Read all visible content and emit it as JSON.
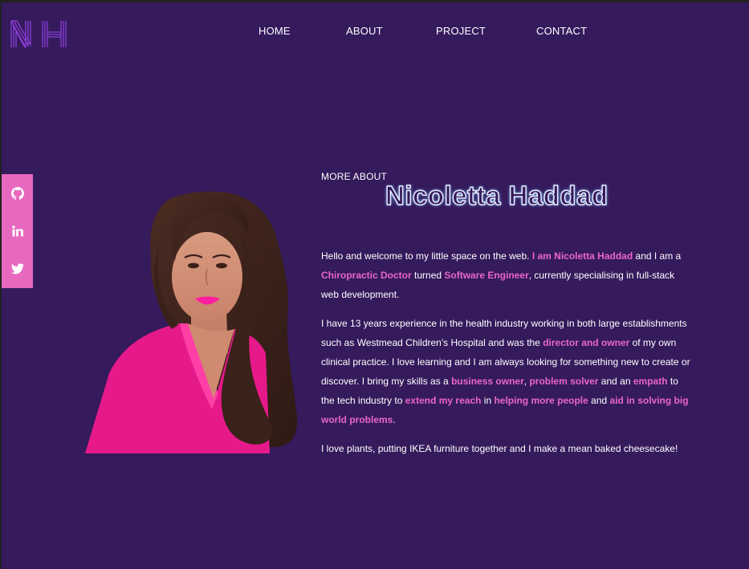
{
  "logo": {
    "text": "NH",
    "icon": "nh-monogram-logo"
  },
  "nav": {
    "home": "HOME",
    "about": "ABOUT",
    "project": "PROJECT",
    "contact": "CONTACT"
  },
  "social": {
    "github_icon": "github-icon",
    "linkedin_icon": "linkedin-icon",
    "twitter_icon": "twitter-icon"
  },
  "about": {
    "kicker": "MORE ABOUT",
    "name": "Nicoletta Haddad",
    "p1": [
      {
        "t": "Hello and welcome to my little space on the web. ",
        "hl": false
      },
      {
        "t": "I am Nicoletta Haddad",
        "hl": true
      },
      {
        "t": " and I am a ",
        "hl": false
      },
      {
        "t": "Chiropractic Doctor",
        "hl": true
      },
      {
        "t": " turned ",
        "hl": false
      },
      {
        "t": "Software Engineer",
        "hl": true
      },
      {
        "t": ", currently specialising in full-stack web development.",
        "hl": false
      }
    ],
    "p2": [
      {
        "t": "I have 13 years experience in the health industry working in both large establishments such as Westmead Children's Hospital and was the ",
        "hl": false
      },
      {
        "t": "director and owner",
        "hl": true
      },
      {
        "t": " of my own clinical practice. I love learning and I am always looking for something new to create or discover. I bring my skills as a ",
        "hl": false
      },
      {
        "t": "business owner",
        "hl": true
      },
      {
        "t": ", ",
        "hl": false
      },
      {
        "t": "problem solver",
        "hl": true
      },
      {
        "t": " and an ",
        "hl": false
      },
      {
        "t": "empath",
        "hl": true
      },
      {
        "t": " to the tech industry to ",
        "hl": false
      },
      {
        "t": "extend my reach",
        "hl": true
      },
      {
        "t": " in ",
        "hl": false
      },
      {
        "t": "helping more people",
        "hl": true
      },
      {
        "t": " and ",
        "hl": false
      },
      {
        "t": "aid in solving big world problems",
        "hl": true
      },
      {
        "t": ".",
        "hl": false
      }
    ],
    "p3": [
      {
        "t": "I love plants, putting IKEA furniture together and I make a mean baked cheesecake!",
        "hl": false
      }
    ]
  },
  "colors": {
    "background": "#351a5c",
    "accent": "#ea66c6",
    "sidebar": "#e868c0",
    "logo": "#8b3fd9"
  }
}
